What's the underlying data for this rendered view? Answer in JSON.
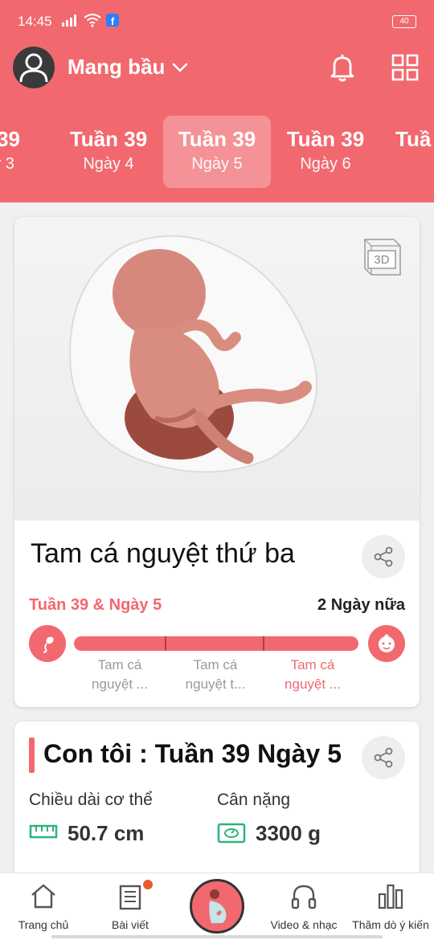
{
  "status_bar": {
    "time": "14:45",
    "battery": "40"
  },
  "header": {
    "title": "Mang bầu"
  },
  "week_tabs": [
    {
      "week": "n 39",
      "day": "ày 3"
    },
    {
      "week": "Tuần 39",
      "day": "Ngày 4"
    },
    {
      "week": "Tuần 39",
      "day": "Ngày 5",
      "active": true
    },
    {
      "week": "Tuần 39",
      "day": "Ngày 6"
    },
    {
      "week": "Tuầ",
      "day": ""
    }
  ],
  "trimester_card": {
    "badge": "3D",
    "title": "Tam cá nguyệt thứ ba",
    "current": "Tuần 39 & Ngày 5",
    "remaining": "2 Ngày nữa",
    "progress": 1.0,
    "trimester_labels": [
      {
        "line1": "Tam cá",
        "line2": "nguyệt ..."
      },
      {
        "line1": "Tam cá",
        "line2": "nguyệt t..."
      },
      {
        "line1": "Tam cá",
        "line2": "nguyệt ..."
      }
    ]
  },
  "my_baby_card": {
    "title": "Con tôi : Tuần 39 Ngày 5",
    "length_label": "Chiều dài cơ thể",
    "length_value": "50.7 cm",
    "weight_label": "Cân nặng",
    "weight_value": "3300 g"
  },
  "bottom_nav": [
    {
      "label": "Trang chủ"
    },
    {
      "label": "Bài viết"
    },
    {
      "label": ""
    },
    {
      "label": "Video & nhạc"
    },
    {
      "label": "Thăm dò ý kiến"
    }
  ],
  "colors": {
    "accent": "#f2686f",
    "icon_green": "#2db37a",
    "notification": "#e85a2e"
  }
}
